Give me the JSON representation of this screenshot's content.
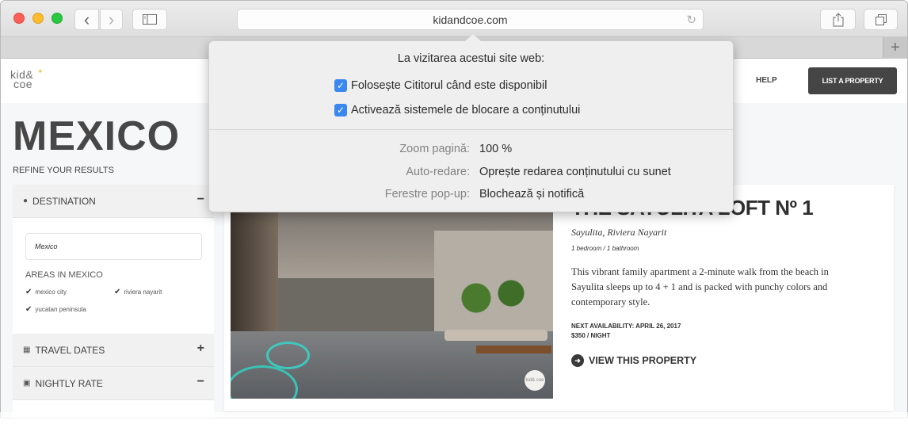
{
  "browser": {
    "url": "kidandcoe.com",
    "buttons": {
      "back": "‹",
      "forward": "›",
      "sidebar": "▯",
      "share": "⇪",
      "tabs": "⧉",
      "reload": "↻",
      "new_tab": "+"
    }
  },
  "site": {
    "logo_line1": "kid&",
    "logo_line2": "coe",
    "nav": {
      "help": "HELP",
      "list_property": "LIST A PROPERTY"
    },
    "page_title": "MEXICO",
    "refine_label": "REFINE YOUR RESULTS",
    "filters": {
      "destination": {
        "label": "DESTINATION",
        "toggle": "−",
        "input_value": "Mexico",
        "areas_label": "AREAS IN MEXICO",
        "areas": [
          {
            "label": "mexico city",
            "checked": true
          },
          {
            "label": "riviera nayarit",
            "checked": true
          },
          {
            "label": "yucatan peninsula",
            "checked": true
          }
        ]
      },
      "travel_dates": {
        "label": "TRAVEL DATES",
        "toggle": "+"
      },
      "nightly_rate": {
        "label": "NIGHTLY RATE",
        "toggle": "−"
      }
    },
    "property": {
      "title": "THE SAYULITA LOFT Nº 1",
      "location": "Sayulita, Riviera Nayarit",
      "rooms": "1 bedroom / 1 bathroom",
      "description": "This vibrant family apartment a 2-minute walk from the beach in Sayulita sleeps up to 4 + 1 and is packed with punchy colors and contemporary style.",
      "availability": "NEXT AVAILABILITY: APRIL 26, 2017",
      "price": "$350 / NIGHT",
      "view_link": "VIEW THIS PROPERTY",
      "photo_badge": "kid& coe"
    }
  },
  "popover": {
    "heading": "La vizitarea acestui site web:",
    "checkboxes": [
      {
        "label": "Folosește Cititorul când este disponibil",
        "checked": true
      },
      {
        "label": "Activează sistemele de blocare a conținutului",
        "checked": true
      }
    ],
    "settings": [
      {
        "label": "Zoom pagină:",
        "value": "100 %"
      },
      {
        "label": "Auto-redare:",
        "value": "Oprește redarea conținutului cu sunet"
      },
      {
        "label": "Ferestre pop-up:",
        "value": "Blochează și notifică"
      }
    ],
    "accent_color": "#3b87f0"
  }
}
